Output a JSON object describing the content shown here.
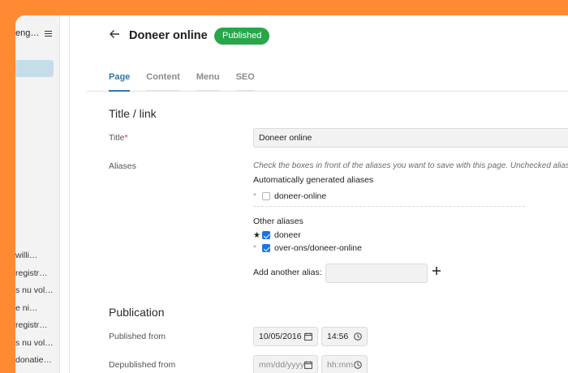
{
  "sidebar": {
    "title": "eng…",
    "items": [
      "willi…",
      "registr…",
      "s nu vol…",
      "e ni…",
      "registr…",
      "s nu vol…",
      "donatie…"
    ]
  },
  "header": {
    "title": "Doneer online",
    "status": "Published"
  },
  "tabs": [
    "Page",
    "Content",
    "Menu",
    "SEO"
  ],
  "title_link": {
    "section": "Title / link",
    "title_label": "Title",
    "title_required": "*",
    "title_value": "Doneer online",
    "aliases_label": "Aliases",
    "aliases_hint": "Check the boxes in front of the aliases you want to save with this page. Unchecked aliases will be removed.",
    "auto_heading": "Automatically generated aliases",
    "auto_aliases": [
      {
        "alias": "doneer-online",
        "checked": false,
        "star": "*"
      }
    ],
    "other_heading": "Other aliases",
    "other_aliases": [
      {
        "alias": "doneer",
        "checked": true,
        "star": "★"
      },
      {
        "alias": "over-ons/doneer-online",
        "checked": true,
        "star": "*"
      }
    ],
    "add_alias_label": "Add another alias:",
    "add_alias_value": ""
  },
  "publication": {
    "section": "Publication",
    "published_from_label": "Published from",
    "published_date": "10/05/2016",
    "published_time": "14:56",
    "depublished_from_label": "Depublished from",
    "depublished_date_placeholder": "mm/dd/yyyy",
    "depublished_time_placeholder": "hh:mm"
  },
  "colors": {
    "accent": "#2f79a8",
    "published_badge": "#27a64a",
    "background": "#ff8a33"
  },
  "icons": [
    "back-arrow-icon",
    "menu-icon",
    "calendar-icon",
    "clock-icon",
    "plus-icon",
    "checkbox-icon"
  ]
}
